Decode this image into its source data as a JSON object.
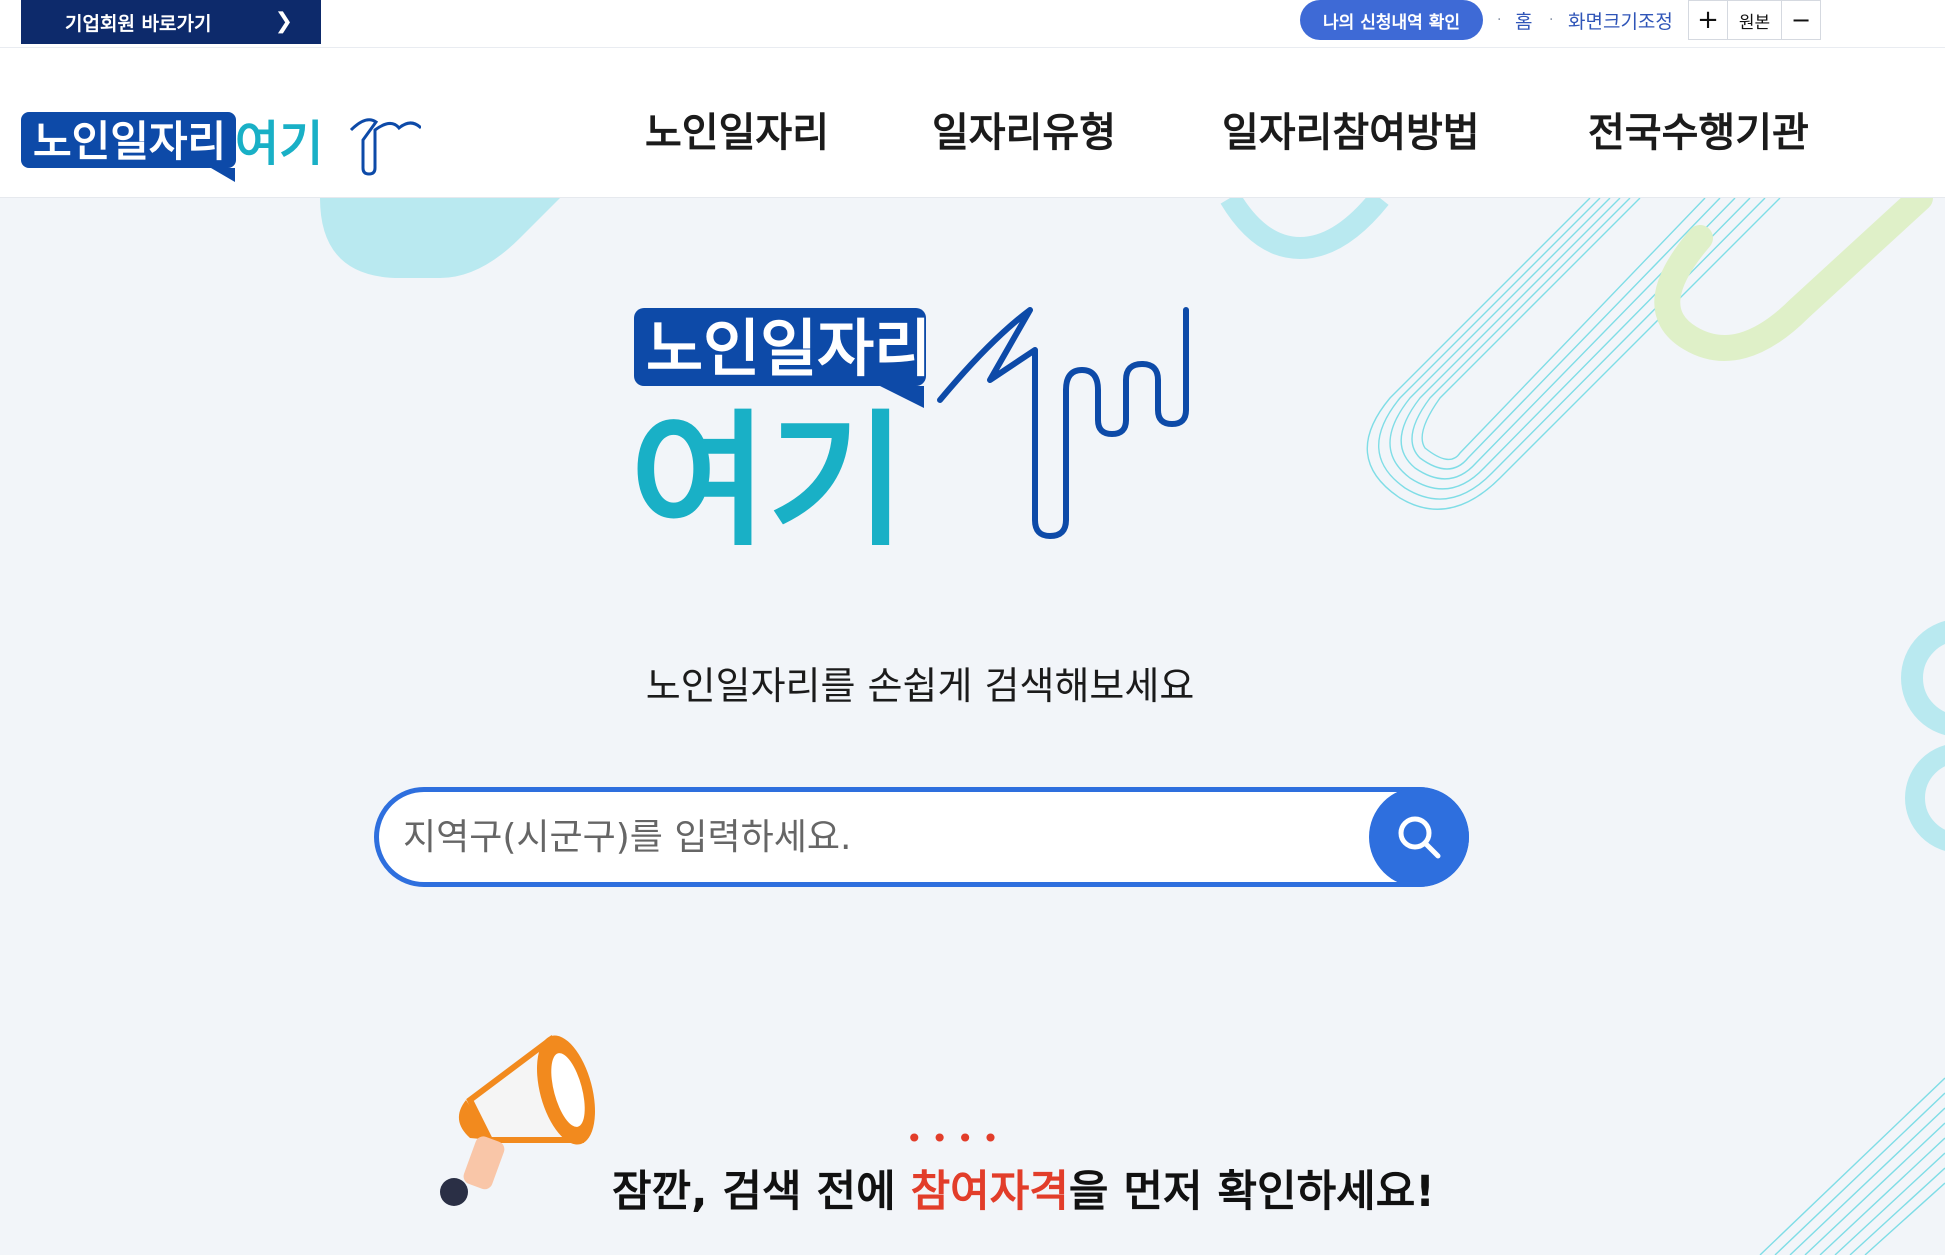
{
  "topbar": {
    "corp_link": "기업회원 바로가기",
    "my_apply": "나의 신청내역 확인",
    "home": "홈",
    "font_size": "화면크기조정",
    "zoom_in": "+",
    "zoom_reset": "원본",
    "zoom_out": "−"
  },
  "header": {
    "logo_text_1": "노인일자리",
    "logo_text_2": "여기",
    "nav": [
      "노인일자리",
      "일자리유형",
      "일자리참여방법",
      "전국수행기관"
    ]
  },
  "hero": {
    "logo_text_1": "노인일자리",
    "logo_text_2": "여기",
    "title": "노인일자리를 손쉽게 검색해보세요",
    "search_placeholder": "지역구(시군구)를 입력하세요."
  },
  "notice": {
    "prefix": "잠깐, 검색 전에 ",
    "highlight": "참여자격",
    "suffix": "을 먼저 확인하세요!",
    "dots": "• • • •"
  },
  "colors": {
    "navy": "#0d2a6b",
    "blue": "#2e6fde",
    "teal": "#19b0c6",
    "red": "#e23d2a",
    "background": "#f2f5f9"
  }
}
